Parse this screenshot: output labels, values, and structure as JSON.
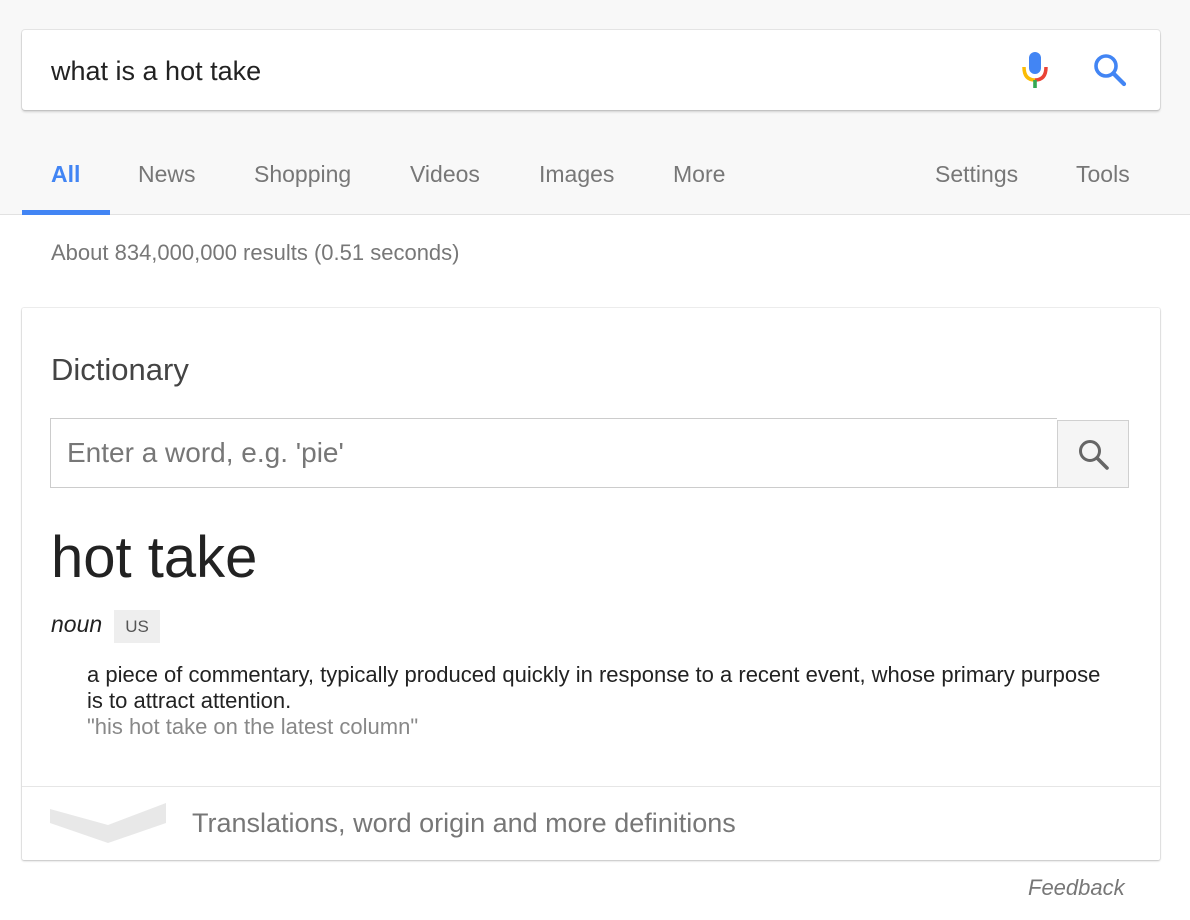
{
  "search": {
    "query": "what is a hot take",
    "mic_icon": "microphone-icon",
    "search_icon": "search-icon"
  },
  "tabs": [
    {
      "label": "All",
      "active": true
    },
    {
      "label": "News"
    },
    {
      "label": "Shopping"
    },
    {
      "label": "Videos"
    },
    {
      "label": "Images"
    },
    {
      "label": "More"
    },
    {
      "label": "Settings"
    },
    {
      "label": "Tools"
    }
  ],
  "results": {
    "stats": "About 834,000,000 results (0.51 seconds)"
  },
  "dictionary": {
    "title": "Dictionary",
    "input_placeholder": "Enter a word, e.g. 'pie'",
    "headword": "hot take",
    "part_of_speech": "noun",
    "region": "US",
    "definition": "a piece of commentary, typically produced quickly in response to a recent event, whose primary purpose is to attract attention.",
    "example": "\"his hot take on the latest column\"",
    "more_label": "Translations, word origin and more definitions"
  },
  "footer": {
    "feedback": "Feedback"
  },
  "colors": {
    "accent": "#4285f4",
    "background_band": "#f8f8f8",
    "muted_text": "#777777"
  }
}
